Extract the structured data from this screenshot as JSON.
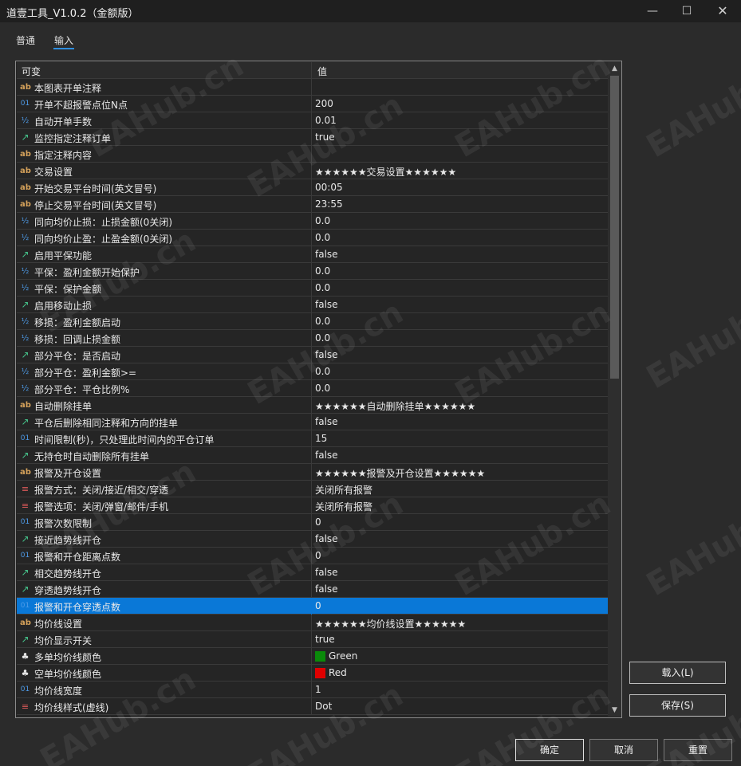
{
  "window": {
    "title": "道壹工具_V1.0.2（金额版）",
    "minimize": "—",
    "maximize": "☐",
    "close": "✕"
  },
  "tabs": [
    {
      "label": "普通",
      "active": false
    },
    {
      "label": "输入",
      "active": true
    }
  ],
  "grid": {
    "col_variable": "可变",
    "col_value": "值",
    "rows": [
      {
        "type": "ab",
        "name": "本图表开单注释",
        "value": ""
      },
      {
        "type": "01",
        "name": "开单不超报警点位N点",
        "value": "200"
      },
      {
        "type": "half",
        "name": "自动开单手数",
        "value": "0.01"
      },
      {
        "type": "bool",
        "name": "监控指定注释订单",
        "value": "true"
      },
      {
        "type": "ab",
        "name": "指定注释内容",
        "value": ""
      },
      {
        "type": "ab",
        "name": "交易设置",
        "value": "★★★★★★交易设置★★★★★★"
      },
      {
        "type": "ab",
        "name": "开始交易平台时间(英文冒号)",
        "value": "00:05"
      },
      {
        "type": "ab",
        "name": "停止交易平台时间(英文冒号)",
        "value": "23:55"
      },
      {
        "type": "half",
        "name": "同向均价止损：止损金额(0关闭)",
        "value": "0.0"
      },
      {
        "type": "half",
        "name": "同向均价止盈：止盈金额(0关闭)",
        "value": "0.0"
      },
      {
        "type": "bool",
        "name": "启用平保功能",
        "value": "false"
      },
      {
        "type": "half",
        "name": "平保：盈利金额开始保护",
        "value": "0.0"
      },
      {
        "type": "half",
        "name": "平保：保护金额",
        "value": "0.0"
      },
      {
        "type": "bool",
        "name": "启用移动止损",
        "value": "false"
      },
      {
        "type": "half",
        "name": "移损：盈利金额启动",
        "value": "0.0"
      },
      {
        "type": "half",
        "name": "移损：回调止损金额",
        "value": "0.0"
      },
      {
        "type": "bool",
        "name": "部分平仓：是否启动",
        "value": "false"
      },
      {
        "type": "half",
        "name": "部分平仓：盈利金额>=",
        "value": "0.0"
      },
      {
        "type": "half",
        "name": "部分平仓：平仓比例%",
        "value": "0.0"
      },
      {
        "type": "ab",
        "name": "自动删除挂单",
        "value": "★★★★★★自动删除挂单★★★★★★"
      },
      {
        "type": "bool",
        "name": "平仓后删除相同注释和方向的挂单",
        "value": "false"
      },
      {
        "type": "01",
        "name": "时间限制(秒)，只处理此时间内的平仓订单",
        "value": "15"
      },
      {
        "type": "bool",
        "name": "无持仓时自动删除所有挂单",
        "value": "false"
      },
      {
        "type": "ab",
        "name": "报警及开仓设置",
        "value": "★★★★★★报警及开仓设置★★★★★★"
      },
      {
        "type": "enum",
        "name": "报警方式：关闭/接近/相交/穿透",
        "value": "关闭所有报警"
      },
      {
        "type": "enum",
        "name": "报警选项：关闭/弹窗/邮件/手机",
        "value": "关闭所有报警"
      },
      {
        "type": "01",
        "name": "报警次数限制",
        "value": "0"
      },
      {
        "type": "bool",
        "name": "接近趋势线开仓",
        "value": "false"
      },
      {
        "type": "01",
        "name": "报警和开仓距离点数",
        "value": "0"
      },
      {
        "type": "bool",
        "name": "相交趋势线开仓",
        "value": "false"
      },
      {
        "type": "bool",
        "name": "穿透趋势线开仓",
        "value": "false"
      },
      {
        "type": "01",
        "name": "报警和开仓穿透点数",
        "value": "0",
        "selected": true
      },
      {
        "type": "ab",
        "name": "均价线设置",
        "value": "★★★★★★均价线设置★★★★★★"
      },
      {
        "type": "bool",
        "name": "均价显示开关",
        "value": "true"
      },
      {
        "type": "color",
        "name": "多单均价线颜色",
        "value": "Green",
        "swatch": "#0a8a0a"
      },
      {
        "type": "color",
        "name": "空单均价线颜色",
        "value": "Red",
        "swatch": "#e00000"
      },
      {
        "type": "01",
        "name": "均价线宽度",
        "value": "1"
      },
      {
        "type": "enum",
        "name": "均价线样式(虚线)",
        "value": "Dot"
      }
    ]
  },
  "buttons": {
    "load": "载入(L)",
    "save": "保存(S)",
    "ok": "确定",
    "cancel": "取消",
    "reset": "重置"
  },
  "watermark": "EAHub.cn",
  "icons": {
    "ab": "ab",
    "01": "01",
    "half": "½",
    "bool": "↗",
    "enum": "≡",
    "color": "♣"
  }
}
